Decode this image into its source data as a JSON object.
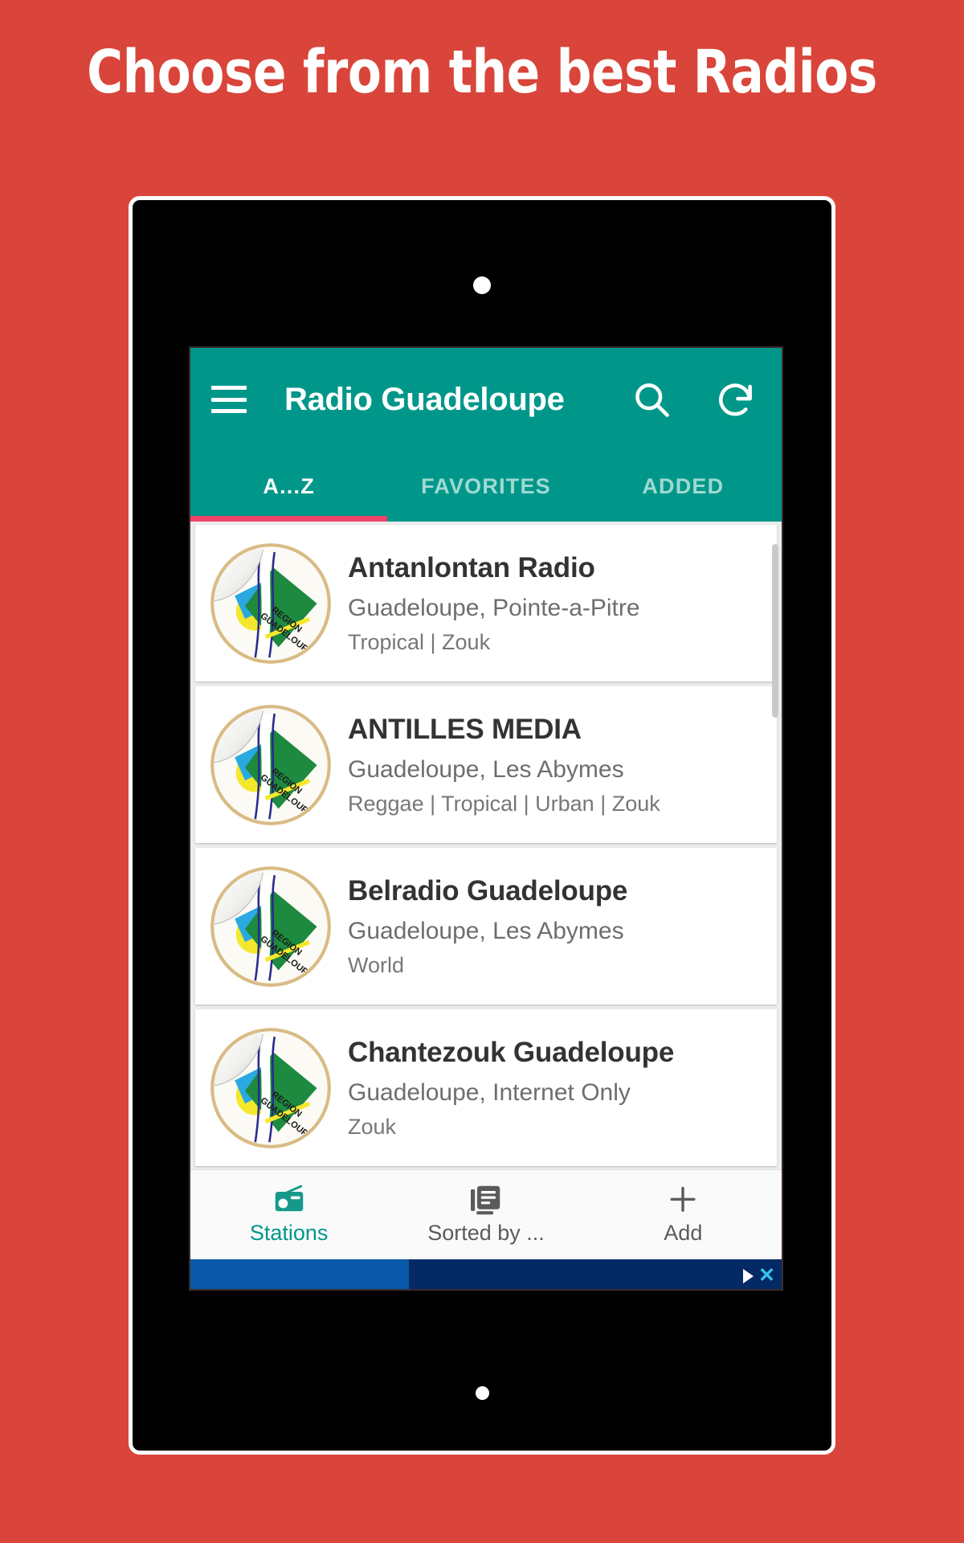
{
  "promo": {
    "headline": "Choose from the best Radios",
    "background_color": "#d9453a",
    "text_color": "#ffffff"
  },
  "app": {
    "accent_color": "#00978a",
    "tab_indicator_color": "#f2426b",
    "title": "Radio Guadeloupe",
    "menu_icon": "hamburger-menu-icon",
    "actions": [
      {
        "name": "search-icon",
        "label": "Search"
      },
      {
        "name": "refresh-icon",
        "label": "Refresh"
      }
    ]
  },
  "tabs": {
    "items": [
      {
        "label": "A...Z",
        "active": true
      },
      {
        "label": "FAVORITES",
        "active": false
      },
      {
        "label": "ADDED",
        "active": false
      }
    ]
  },
  "stations": [
    {
      "name": "Antanlontan Radio",
      "location": "Guadeloupe, Pointe-a-Pitre",
      "genres": "Tropical | Zouk",
      "logo": "region-guadeloupe-sticker-logo"
    },
    {
      "name": "ANTILLES MEDIA",
      "location": "Guadeloupe, Les Abymes",
      "genres": "Reggae | Tropical | Urban | Zouk",
      "logo": "region-guadeloupe-sticker-logo"
    },
    {
      "name": "Belradio Guadeloupe",
      "location": "Guadeloupe, Les Abymes",
      "genres": "World",
      "logo": "region-guadeloupe-sticker-logo"
    },
    {
      "name": "Chantezouk Guadeloupe",
      "location": "Guadeloupe, Internet Only",
      "genres": "Zouk",
      "logo": "region-guadeloupe-sticker-logo"
    }
  ],
  "bottom_nav": {
    "items": [
      {
        "label": "Stations",
        "icon": "radio-icon",
        "active": true
      },
      {
        "label": "Sorted by ...",
        "icon": "list-sort-icon",
        "active": false
      },
      {
        "label": "Add",
        "icon": "plus-icon",
        "active": false
      }
    ]
  },
  "ad_banner": {
    "adchoices_icon": "adchoices-triangle-icon",
    "close_label": "✕",
    "left_color": "#0a59a8",
    "right_color": "#042a66",
    "close_color": "#35c4f0"
  },
  "logo_text": {
    "line1": "REGION",
    "line2": "GUADELOUPE"
  }
}
